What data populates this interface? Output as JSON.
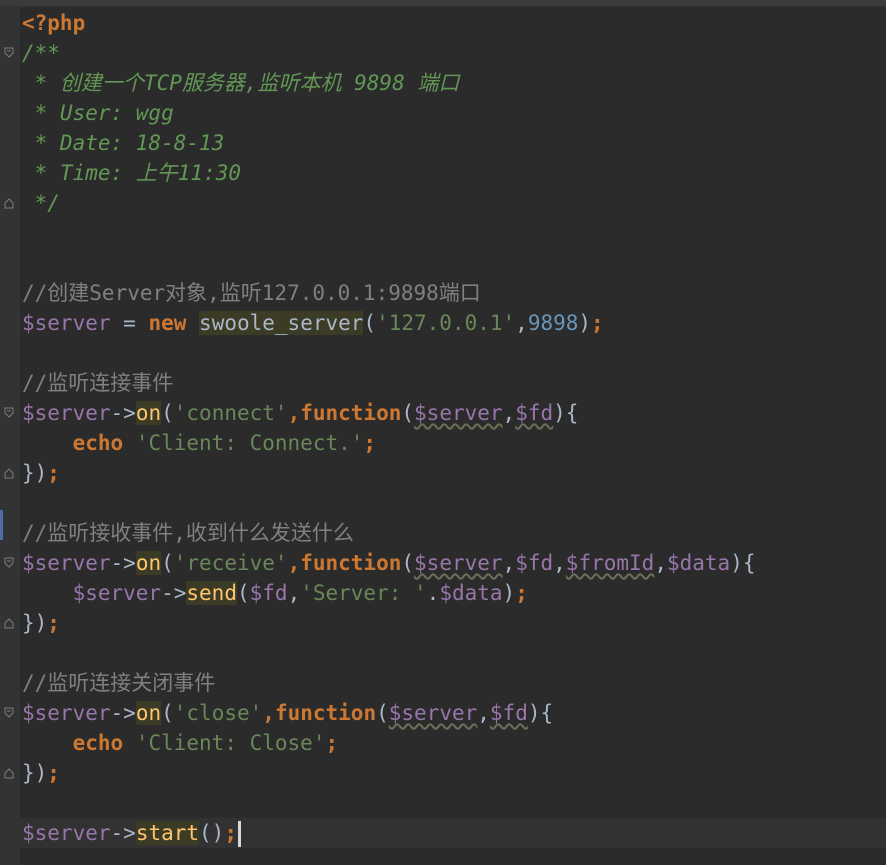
{
  "code": {
    "php_open": "<?php",
    "doc_open": "/**",
    "doc_line1": " * 创建一个TCP服务器,监听本机 9898 端口",
    "doc_line2": " * User: wgg",
    "doc_line3": " * Date: 18-8-13",
    "doc_line4": " * Time: 上午11:30",
    "doc_close": " */",
    "comment_server": "//创建Server对象,监听127.0.0.1:9898端口",
    "server_var": "$server",
    "assign": " = ",
    "kw_new": "new",
    "class_swoole": "swoole_server",
    "str_ip": "'127.0.0.1'",
    "num_port": "9898",
    "comment_connect": "//监听连接事件",
    "arrow": "->",
    "method_on": "on",
    "evt_connect": "'connect'",
    "kw_function": "function",
    "param_server": "$server",
    "param_fd": "$fd",
    "param_fromid": "$fromId",
    "param_data": "$data",
    "kw_echo": "echo",
    "str_connect": "'Client: Connect.'",
    "comment_receive": "//监听接收事件,收到什么发送什么",
    "evt_receive": "'receive'",
    "method_send": "send",
    "str_server": "'Server: '",
    "comment_close": "//监听连接关闭事件",
    "evt_close": "'close'",
    "str_close": "'Client: Close'",
    "method_start": "start"
  },
  "colors": {
    "background": "#2b2b2b",
    "gutter": "#313335",
    "keyword": "#cc7832",
    "doc_comment": "#629755",
    "comment": "#808080",
    "variable": "#9876aa",
    "string": "#6a8759",
    "number": "#6897bb",
    "function": "#ffc66d"
  },
  "icons": {
    "fold": "fold-icon"
  }
}
